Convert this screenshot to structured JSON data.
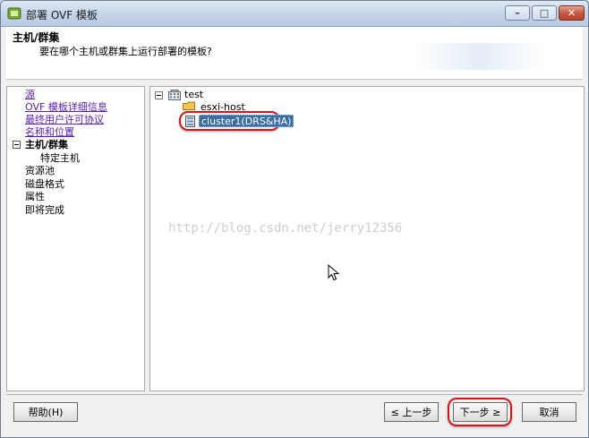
{
  "window": {
    "title": "部署 OVF 模板",
    "controls": {
      "minimize": "–",
      "maximize": "□",
      "close": "✕"
    }
  },
  "header": {
    "title": "主机/群集",
    "subtitle": "要在哪个主机或群集上运行部署的模板?"
  },
  "steps": [
    {
      "label": "源",
      "state": "link"
    },
    {
      "label": "OVF 模板详细信息",
      "state": "link"
    },
    {
      "label": "最终用户许可协议",
      "state": "link"
    },
    {
      "label": "名称和位置",
      "state": "link"
    },
    {
      "label": "主机/群集",
      "state": "current"
    },
    {
      "label": "特定主机",
      "state": "sub"
    },
    {
      "label": "资源池",
      "state": "pending"
    },
    {
      "label": "磁盘格式",
      "state": "pending"
    },
    {
      "label": "属性",
      "state": "pending"
    },
    {
      "label": "即将完成",
      "state": "pending"
    }
  ],
  "tree": {
    "root": "test",
    "children": [
      {
        "label": "esxi-host",
        "icon": "folder-icon"
      },
      {
        "label": "cluster1(DRS&HA)",
        "icon": "cluster-icon",
        "selected": true
      }
    ]
  },
  "watermark": "http://blog.csdn.net/jerry12356",
  "buttons": {
    "help": "帮助(H)",
    "back": "≤ 上一步",
    "next": "下一步 ≥",
    "cancel": "取消"
  },
  "colors": {
    "highlight_red": "#d8141b",
    "selection_blue": "#3a6ea5",
    "link_purple": "#5a1cbe"
  }
}
